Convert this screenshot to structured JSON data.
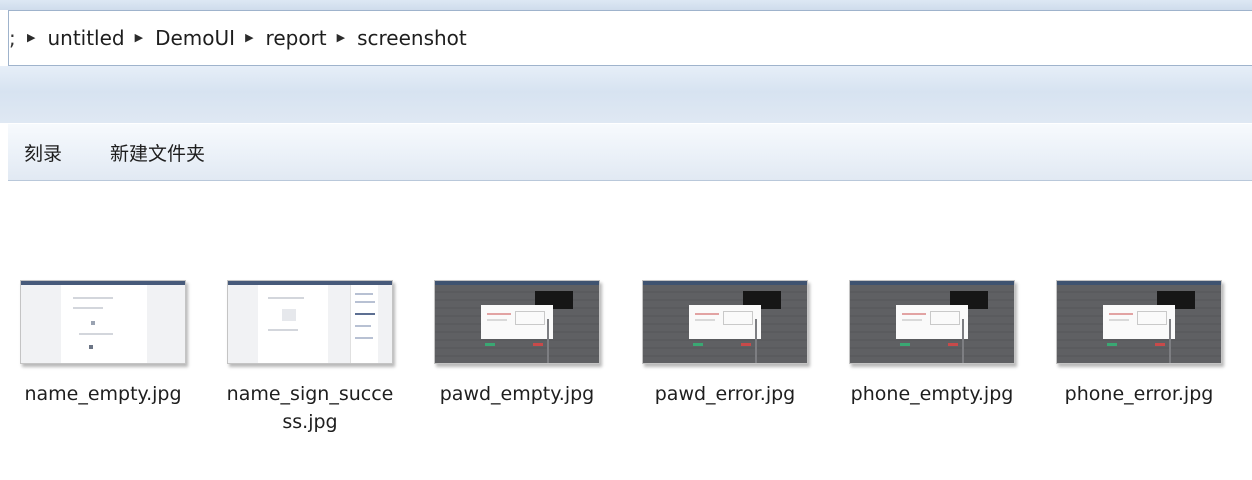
{
  "breadcrumb": {
    "items": [
      "untitled",
      "DemoUI",
      "report",
      "screenshot"
    ]
  },
  "toolbar": {
    "burn_label": "刻录",
    "new_folder_label": "新建文件夹"
  },
  "files": [
    {
      "name": "name_empty.jpg",
      "thumbnail": "light-webpage"
    },
    {
      "name": "name_sign_success.jpg",
      "thumbnail": "light-webpage"
    },
    {
      "name": "pawd_empty.jpg",
      "thumbnail": "dark-dialog"
    },
    {
      "name": "pawd_error.jpg",
      "thumbnail": "dark-dialog"
    },
    {
      "name": "phone_empty.jpg",
      "thumbnail": "dark-dialog"
    },
    {
      "name": "phone_error.jpg",
      "thumbnail": "dark-dialog"
    }
  ],
  "colors": {
    "chrome_blue": "#d7e3f1",
    "address_border": "#9fb3cc",
    "text": "#1e1e1e"
  },
  "icons": {
    "breadcrumb_separator": "triangle-right-icon"
  }
}
